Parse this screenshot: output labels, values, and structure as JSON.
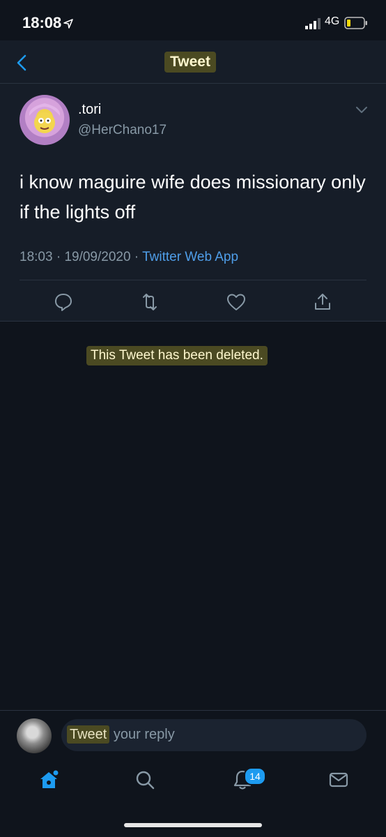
{
  "status_bar": {
    "time": "18:08",
    "network": "4G"
  },
  "header": {
    "title": "Tweet"
  },
  "tweet": {
    "display_name": ".tori",
    "handle": "@HerChano17",
    "text": "i know maguire wife does missionary only if the lights off",
    "time": "18:03",
    "separator": " · ",
    "date": "19/09/2020",
    "source": "Twitter Web App"
  },
  "deleted_notice": "This Tweet has been deleted.",
  "reply": {
    "placeholder_highlight": "Tweet",
    "placeholder_rest": " your reply"
  },
  "tabs": {
    "notifications_count": "14"
  },
  "colors": {
    "accent": "#1d9bf0",
    "background": "#0f141c",
    "card": "#161d28",
    "muted": "#8899a6",
    "highlight": "#4b4a22"
  }
}
